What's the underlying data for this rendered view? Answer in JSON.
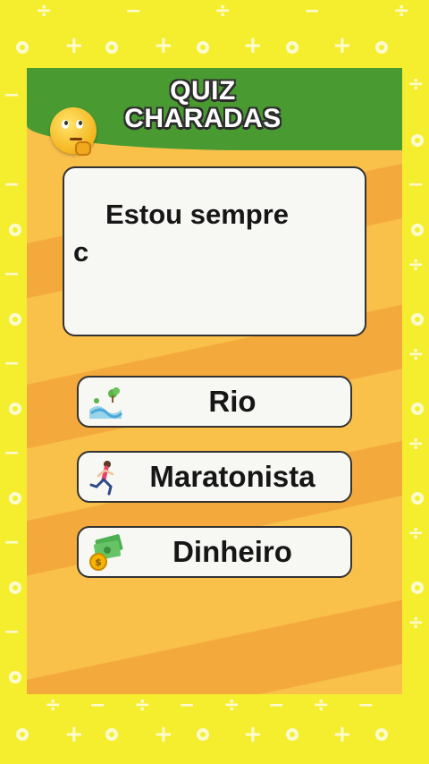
{
  "header": {
    "title_line1": "QUIZ",
    "title_line2": "CHARADAS",
    "mascot_icon": "thinking-face-icon"
  },
  "question": {
    "line1": "Estou sempre",
    "line2": "c"
  },
  "answers": [
    {
      "label": "Rio",
      "icon": "river-icon"
    },
    {
      "label": "Maratonista",
      "icon": "runner-icon"
    },
    {
      "label": "Dinheiro",
      "icon": "money-icon"
    }
  ],
  "colors": {
    "background": "#f5ee2e",
    "header_green": "#4a9a32",
    "panel_orange": "#f9c04a",
    "card": "#f7f7f4"
  }
}
